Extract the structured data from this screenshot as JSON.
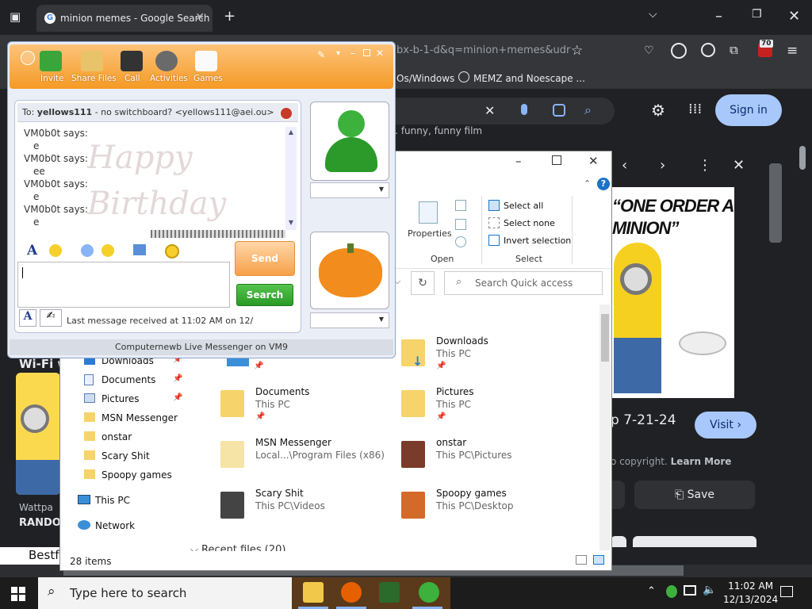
{
  "browser": {
    "tab_title": "minion memes - Google Search",
    "url_fragment": "bx-b-1-d&q=minion+memes&udr",
    "bookmarks": [
      "Os/Windows",
      "MEMZ and Noescape ..."
    ],
    "extension_badge": "70"
  },
  "google": {
    "signin_label": "Sign in",
    "snippet": "… funny, funny film",
    "image_heading": "“ONE ORDER A MINION”",
    "caption": "p 7-21-24",
    "visit_label": "Visit",
    "copyright": "o copyright.",
    "learn_more": "Learn More",
    "save_label": "Save",
    "left_thumb_text": "Wi-Fi w",
    "left_source": "Wattpa",
    "left_title": "RANDO",
    "bestf": "Bestf"
  },
  "explorer": {
    "ribbon": {
      "properties_label": "Properties",
      "open_group": "Open",
      "select_all": "Select all",
      "select_none": "Select none",
      "invert_selection": "Invert selection",
      "select_group": "Select"
    },
    "search_placeholder": "Search Quick access",
    "nav_items": [
      {
        "label": "Downloads",
        "pinned": true
      },
      {
        "label": "Documents",
        "pinned": true
      },
      {
        "label": "Pictures",
        "pinned": true
      },
      {
        "label": "MSN Messenger"
      },
      {
        "label": "onstar"
      },
      {
        "label": "Scary Shit"
      },
      {
        "label": "Spoopy games"
      },
      {
        "label": "This PC"
      },
      {
        "label": "Network"
      }
    ],
    "items": [
      {
        "name": "Downloads",
        "location": "This PC"
      },
      {
        "name": "Documents",
        "location": "This PC"
      },
      {
        "name": "Pictures",
        "location": "This PC"
      },
      {
        "name": "MSN Messenger",
        "location": "Local...\\Program Files (x86)"
      },
      {
        "name": "onstar",
        "location": "This PC\\Pictures"
      },
      {
        "name": "Scary Shit",
        "location": "This PC\\Videos"
      },
      {
        "name": "Spoopy games",
        "location": "This PC\\Desktop"
      }
    ],
    "recent_header": "Recent files (20)",
    "status": "28 items"
  },
  "messenger": {
    "toolbar": [
      "Invite",
      "Share Files",
      "Call",
      "Activities",
      "Games"
    ],
    "to_line": "To:",
    "to_name": "yellows111",
    "to_detail": "- no switchboard? <yellows111@aei.ou>",
    "history": [
      {
        "sender": "VM0b0t says:",
        "text": "e"
      },
      {
        "sender": "VM0b0t says:",
        "text": "ee"
      },
      {
        "sender": "VM0b0t says:",
        "text": "e"
      },
      {
        "sender": "VM0b0t says:",
        "text": "e"
      }
    ],
    "background_text": "Happy Birthday",
    "send_label": "Send",
    "search_label": "Search",
    "last_message": "Last message received at 11:02 AM on 12/",
    "status_footer": "Computernewb Live Messenger on VM9"
  },
  "taskbar": {
    "search_placeholder": "Type here to search",
    "time": "11:02 AM",
    "date": "12/13/2024"
  },
  "colors": {
    "msn_orange": "#f59a25",
    "google_blue": "#a8c7fa",
    "search_green": "#2a9a26"
  }
}
